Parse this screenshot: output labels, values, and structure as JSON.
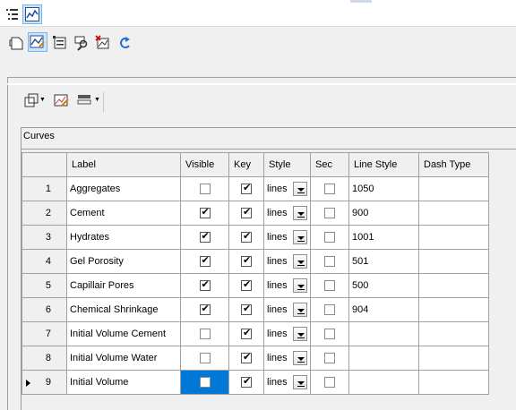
{
  "toolbar_icons": {
    "top": [
      "list-view-icon",
      "chart-view-icon"
    ],
    "main": [
      "document-icon",
      "chart-edit-icon",
      "properties-icon",
      "find-icon",
      "delete-chart-icon",
      "undo-icon"
    ],
    "panel": [
      "layout-icon",
      "edit-curves-icon",
      "format-icon"
    ]
  },
  "curves": {
    "title": "Curves",
    "columns": {
      "label": "Label",
      "visible": "Visible",
      "key": "Key",
      "style": "Style",
      "sec": "Sec",
      "line_style": "Line Style",
      "dash_type": "Dash Type"
    },
    "rows": [
      {
        "num": "1",
        "label": "Aggregates",
        "visible": false,
        "key": true,
        "style": "lines",
        "sec": false,
        "line_style": "1050",
        "dash_type": ""
      },
      {
        "num": "2",
        "label": "Cement",
        "visible": true,
        "key": true,
        "style": "lines",
        "sec": false,
        "line_style": "900",
        "dash_type": ""
      },
      {
        "num": "3",
        "label": "Hydrates",
        "visible": true,
        "key": true,
        "style": "lines",
        "sec": false,
        "line_style": "1001",
        "dash_type": ""
      },
      {
        "num": "4",
        "label": "Gel Porosity",
        "visible": true,
        "key": true,
        "style": "lines",
        "sec": false,
        "line_style": "501",
        "dash_type": ""
      },
      {
        "num": "5",
        "label": "Capillair Pores",
        "visible": true,
        "key": true,
        "style": "lines",
        "sec": false,
        "line_style": "500",
        "dash_type": ""
      },
      {
        "num": "6",
        "label": "Chemical Shrinkage",
        "visible": true,
        "key": true,
        "style": "lines",
        "sec": false,
        "line_style": "904",
        "dash_type": ""
      },
      {
        "num": "7",
        "label": "Initial Volume Cement",
        "visible": false,
        "key": true,
        "style": "lines",
        "sec": false,
        "line_style": "",
        "dash_type": ""
      },
      {
        "num": "8",
        "label": "Initial Volume Water",
        "visible": false,
        "key": true,
        "style": "lines",
        "sec": false,
        "line_style": "",
        "dash_type": ""
      },
      {
        "num": "9",
        "label": "Initial Volume",
        "visible": false,
        "key": true,
        "style": "lines",
        "sec": false,
        "line_style": "",
        "dash_type": "",
        "current": true,
        "selected_cell": "visible"
      }
    ]
  },
  "colors": {
    "selection": "#0078d7",
    "toolbar_selected": "#cce4f7"
  }
}
